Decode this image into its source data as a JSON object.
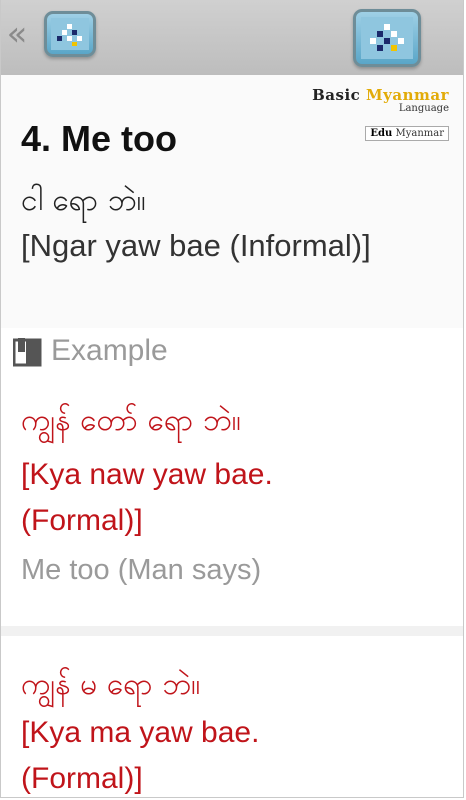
{
  "toolbar": {
    "back_icon": "double-chevron-left-icon",
    "app_icon": "app-logo-icon"
  },
  "brand": {
    "name_prefix": "Basic",
    "name_accent": "Myanmar",
    "subtitle": "Language",
    "badge_bold": "Edu",
    "badge_rest": "Myanmar",
    "accent_color": "#e2ab08"
  },
  "phrase": {
    "title": "4. Me too",
    "myanmar": "ငါ ရော ဘဲ။",
    "romanized": "[Ngar yaw bae (Informal)]"
  },
  "examples_header": {
    "icon": "book-icon",
    "label": "Example"
  },
  "examples": [
    {
      "myanmar": "ကျွန် တော် ရော ဘဲ။",
      "romanized_line1": "[Kya naw yaw bae.",
      "romanized_line2": "(Formal)]",
      "translation": "Me too (Man says)"
    },
    {
      "myanmar": "ကျွန် မ ရော ဘဲ။",
      "romanized_line1": "[Kya ma yaw bae.",
      "romanized_line2": "(Formal)]"
    }
  ],
  "colors": {
    "example_text": "#c0141a",
    "muted_text": "#9a9a9a",
    "toolbar_bg": "#c6c6c6"
  }
}
